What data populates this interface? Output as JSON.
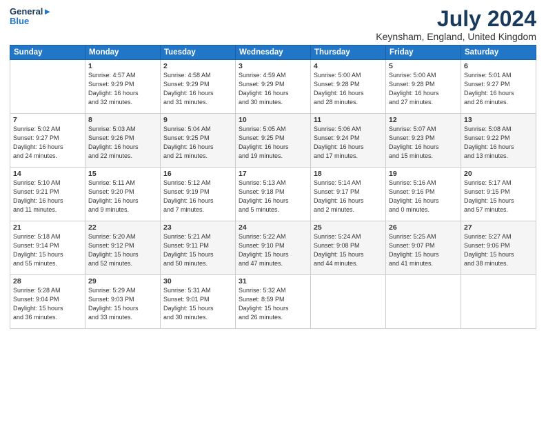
{
  "logo": {
    "line1": "General",
    "line2": "Blue"
  },
  "title": "July 2024",
  "location": "Keynsham, England, United Kingdom",
  "header": {
    "accent_color": "#2176c7"
  },
  "days_of_week": [
    "Sunday",
    "Monday",
    "Tuesday",
    "Wednesday",
    "Thursday",
    "Friday",
    "Saturday"
  ],
  "weeks": [
    [
      {
        "day": "",
        "info": ""
      },
      {
        "day": "1",
        "info": "Sunrise: 4:57 AM\nSunset: 9:29 PM\nDaylight: 16 hours\nand 32 minutes."
      },
      {
        "day": "2",
        "info": "Sunrise: 4:58 AM\nSunset: 9:29 PM\nDaylight: 16 hours\nand 31 minutes."
      },
      {
        "day": "3",
        "info": "Sunrise: 4:59 AM\nSunset: 9:29 PM\nDaylight: 16 hours\nand 30 minutes."
      },
      {
        "day": "4",
        "info": "Sunrise: 5:00 AM\nSunset: 9:28 PM\nDaylight: 16 hours\nand 28 minutes."
      },
      {
        "day": "5",
        "info": "Sunrise: 5:00 AM\nSunset: 9:28 PM\nDaylight: 16 hours\nand 27 minutes."
      },
      {
        "day": "6",
        "info": "Sunrise: 5:01 AM\nSunset: 9:27 PM\nDaylight: 16 hours\nand 26 minutes."
      }
    ],
    [
      {
        "day": "7",
        "info": "Sunrise: 5:02 AM\nSunset: 9:27 PM\nDaylight: 16 hours\nand 24 minutes."
      },
      {
        "day": "8",
        "info": "Sunrise: 5:03 AM\nSunset: 9:26 PM\nDaylight: 16 hours\nand 22 minutes."
      },
      {
        "day": "9",
        "info": "Sunrise: 5:04 AM\nSunset: 9:25 PM\nDaylight: 16 hours\nand 21 minutes."
      },
      {
        "day": "10",
        "info": "Sunrise: 5:05 AM\nSunset: 9:25 PM\nDaylight: 16 hours\nand 19 minutes."
      },
      {
        "day": "11",
        "info": "Sunrise: 5:06 AM\nSunset: 9:24 PM\nDaylight: 16 hours\nand 17 minutes."
      },
      {
        "day": "12",
        "info": "Sunrise: 5:07 AM\nSunset: 9:23 PM\nDaylight: 16 hours\nand 15 minutes."
      },
      {
        "day": "13",
        "info": "Sunrise: 5:08 AM\nSunset: 9:22 PM\nDaylight: 16 hours\nand 13 minutes."
      }
    ],
    [
      {
        "day": "14",
        "info": "Sunrise: 5:10 AM\nSunset: 9:21 PM\nDaylight: 16 hours\nand 11 minutes."
      },
      {
        "day": "15",
        "info": "Sunrise: 5:11 AM\nSunset: 9:20 PM\nDaylight: 16 hours\nand 9 minutes."
      },
      {
        "day": "16",
        "info": "Sunrise: 5:12 AM\nSunset: 9:19 PM\nDaylight: 16 hours\nand 7 minutes."
      },
      {
        "day": "17",
        "info": "Sunrise: 5:13 AM\nSunset: 9:18 PM\nDaylight: 16 hours\nand 5 minutes."
      },
      {
        "day": "18",
        "info": "Sunrise: 5:14 AM\nSunset: 9:17 PM\nDaylight: 16 hours\nand 2 minutes."
      },
      {
        "day": "19",
        "info": "Sunrise: 5:16 AM\nSunset: 9:16 PM\nDaylight: 16 hours\nand 0 minutes."
      },
      {
        "day": "20",
        "info": "Sunrise: 5:17 AM\nSunset: 9:15 PM\nDaylight: 15 hours\nand 57 minutes."
      }
    ],
    [
      {
        "day": "21",
        "info": "Sunrise: 5:18 AM\nSunset: 9:14 PM\nDaylight: 15 hours\nand 55 minutes."
      },
      {
        "day": "22",
        "info": "Sunrise: 5:20 AM\nSunset: 9:12 PM\nDaylight: 15 hours\nand 52 minutes."
      },
      {
        "day": "23",
        "info": "Sunrise: 5:21 AM\nSunset: 9:11 PM\nDaylight: 15 hours\nand 50 minutes."
      },
      {
        "day": "24",
        "info": "Sunrise: 5:22 AM\nSunset: 9:10 PM\nDaylight: 15 hours\nand 47 minutes."
      },
      {
        "day": "25",
        "info": "Sunrise: 5:24 AM\nSunset: 9:08 PM\nDaylight: 15 hours\nand 44 minutes."
      },
      {
        "day": "26",
        "info": "Sunrise: 5:25 AM\nSunset: 9:07 PM\nDaylight: 15 hours\nand 41 minutes."
      },
      {
        "day": "27",
        "info": "Sunrise: 5:27 AM\nSunset: 9:06 PM\nDaylight: 15 hours\nand 38 minutes."
      }
    ],
    [
      {
        "day": "28",
        "info": "Sunrise: 5:28 AM\nSunset: 9:04 PM\nDaylight: 15 hours\nand 36 minutes."
      },
      {
        "day": "29",
        "info": "Sunrise: 5:29 AM\nSunset: 9:03 PM\nDaylight: 15 hours\nand 33 minutes."
      },
      {
        "day": "30",
        "info": "Sunrise: 5:31 AM\nSunset: 9:01 PM\nDaylight: 15 hours\nand 30 minutes."
      },
      {
        "day": "31",
        "info": "Sunrise: 5:32 AM\nSunset: 8:59 PM\nDaylight: 15 hours\nand 26 minutes."
      },
      {
        "day": "",
        "info": ""
      },
      {
        "day": "",
        "info": ""
      },
      {
        "day": "",
        "info": ""
      }
    ]
  ]
}
